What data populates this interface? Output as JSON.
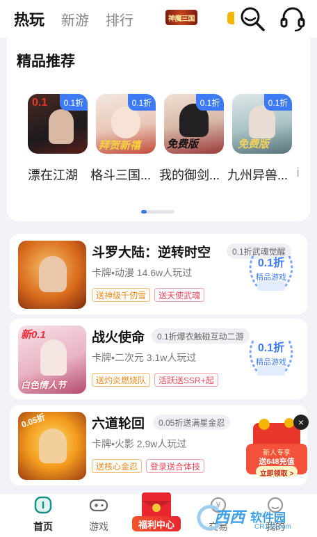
{
  "header": {
    "tabs": [
      {
        "label": "热玩",
        "active": true
      },
      {
        "label": "新游",
        "active": false
      },
      {
        "label": "排行",
        "active": false
      }
    ],
    "logo_text": "神魔三国",
    "icons": [
      "search-icon",
      "headset-icon"
    ]
  },
  "featured": {
    "title": "精品推荐",
    "games": [
      {
        "name": "漂在江湖",
        "discount": "0.1折",
        "art_text": "0.1"
      },
      {
        "name": "格斗三国...",
        "discount": "0.1折",
        "art_text": "拜贺新禧"
      },
      {
        "name": "我的御剑...",
        "discount": "0.1折",
        "art_text": "免费版"
      },
      {
        "name": "九州异兽...",
        "discount": "0.1折",
        "art_text": "免费版"
      }
    ],
    "overflow_glyph": "ⅰ",
    "page_index": 0
  },
  "games": [
    {
      "name": "斗罗大陆：逆转时空",
      "pill": "0.1折武魂觉醒",
      "meta": "卡牌•动漫  14.6w人玩过",
      "tags": [
        {
          "text": "送神级千仞雪",
          "color": "orange"
        },
        {
          "text": "送天使武魂",
          "color": "red"
        }
      ],
      "seal_value": "0.1折",
      "seal_sub": "精品游戏"
    },
    {
      "name": "战火使命",
      "pill": "0.1折爆衣触碰互动二游",
      "meta": "卡牌•二次元  3.1w人玩过",
      "tags": [
        {
          "text": "送灼炎燃烧队",
          "color": "orange"
        },
        {
          "text": "活跃送SSR+起",
          "color": "red"
        }
      ],
      "art_text": "新0.1",
      "art_text2": "白色情人节",
      "seal_value": "0.1折",
      "seal_sub": "精品游戏"
    },
    {
      "name": "六道轮回",
      "pill": "0.05折送满星金忍",
      "meta": "卡牌•火影  2.9w人玩过",
      "tags": [
        {
          "text": "送核心金忍",
          "color": "orange"
        },
        {
          "text": "登录送合体技",
          "color": "red"
        }
      ],
      "art_text": "0.05折"
    }
  ],
  "promo": {
    "line1": "新人专享",
    "line2": "送648充值",
    "button": "立即领取 >",
    "close": "×"
  },
  "bottom_nav": [
    {
      "label": "首页",
      "active": true
    },
    {
      "label": "游戏",
      "active": false
    },
    {
      "label": "福利中心",
      "active": false
    },
    {
      "label": "交易",
      "active": false
    },
    {
      "label": "我的",
      "active": false
    }
  ],
  "watermark": {
    "brand": "西西",
    "sub": "软件园",
    "url": "CR173.com"
  },
  "colors": {
    "accent": "#3d7bf5",
    "orange": "#f08a1a",
    "red": "#ef4a5b",
    "bg": "#f1f3f7"
  }
}
